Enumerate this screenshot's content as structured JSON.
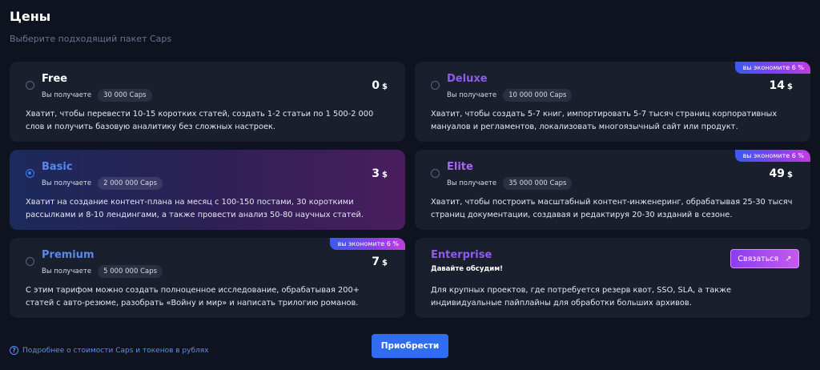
{
  "header": {
    "title": "Цены",
    "subtitle": "Выберите подходящий пакет Caps"
  },
  "receive_label": "Вы получаете",
  "currency": "$",
  "plans": [
    {
      "name": "Free",
      "caps": "30 000 Caps",
      "price": "0",
      "badge": "",
      "selected": false,
      "desc": "Хватит, чтобы перевести 10-15 коротких статей, создать 1-2 статьи по 1 500-2 000 слов и получить базовую аналитику без сложных настроек."
    },
    {
      "name": "Deluxe",
      "caps": "10 000 000 Caps",
      "price": "14",
      "badge": "вы экономите 6 %",
      "selected": false,
      "desc": "Хватит, чтобы создать 5-7 книг, импортировать 5-7 тысяч страниц корпоративных мануалов и регламентов, локализовать многоязычный сайт или продукт."
    },
    {
      "name": "Basic",
      "caps": "2 000 000 Caps",
      "price": "3",
      "badge": "",
      "selected": true,
      "desc": "Хватит на создание контент-плана на месяц с 100-150 постами, 30 короткими рассылками и 8-10 лендингами, а также провести анализ 50-80 научных статей."
    },
    {
      "name": "Elite",
      "caps": "35 000 000 Caps",
      "price": "49",
      "badge": "вы экономите 6 %",
      "selected": false,
      "desc": "Хватит, чтобы построить масштабный контент-инженеринг, обрабатывая 25-30 тысяч страниц документации, создавая и редактируя 20-30 изданий в сезоне."
    },
    {
      "name": "Premium",
      "caps": "5 000 000 Caps",
      "price": "7",
      "badge": "вы экономите 6 %",
      "selected": false,
      "desc": "С этим тарифом можно создать полноценное исследование, обрабатывая 200+ статей с авто-резюме, разобрать «Войну и мир» и написать трилогию романов."
    }
  ],
  "enterprise": {
    "name": "Enterprise",
    "subtitle": "Давайте обсудим!",
    "contact_label": "Связаться",
    "contact_icon": "arrow-up-right-icon",
    "desc": "Для крупных проектов, где потребуется резерв квот, SSO, SLA, а также индивидуальные пайплайны для обработки больших архивов."
  },
  "footer": {
    "link_text": "Подробнее о стоимости Caps и токенов в рублях",
    "link_icon": "question-circle-icon",
    "buy_label": "Приобрести"
  },
  "colors": {
    "background": "#0f1320",
    "card": "#1a1f2e",
    "accent_blue": "#2f6cf0",
    "accent_purple": "#8a3ef0"
  }
}
